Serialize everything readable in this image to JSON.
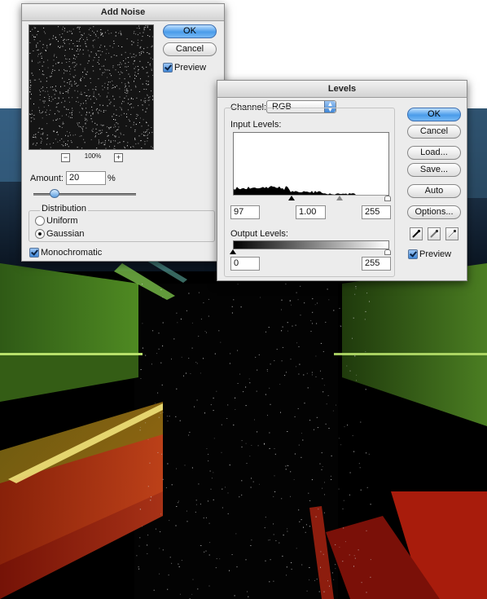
{
  "add_noise": {
    "title": "Add Noise",
    "ok_label": "OK",
    "cancel_label": "Cancel",
    "preview_label": "Preview",
    "preview_checked": true,
    "zoom_label": "100%",
    "zoom_out_symbol": "−",
    "zoom_in_symbol": "+",
    "amount_label": "Amount:",
    "amount_value": "20",
    "amount_unit": "%",
    "amount_level": 0.2,
    "distribution_label": "Distribution",
    "uniform_label": "Uniform",
    "gaussian_label": "Gaussian",
    "selected_distribution": "Gaussian",
    "monochromatic_label": "Monochromatic",
    "monochromatic_checked": true
  },
  "levels": {
    "title": "Levels",
    "channel_label": "Channel:",
    "channel_value": "RGB",
    "input_levels_label": "Input Levels:",
    "input_black": "97",
    "input_gamma": "1.00",
    "input_white": "255",
    "output_levels_label": "Output Levels:",
    "output_black": "0",
    "output_white": "255",
    "ok_label": "OK",
    "cancel_label": "Cancel",
    "load_label": "Load...",
    "save_label": "Save...",
    "auto_label": "Auto",
    "options_label": "Options...",
    "preview_label": "Preview",
    "preview_checked": true
  },
  "colors": {
    "default_button": "#4a9cea",
    "dialog_bg": "#ececec",
    "canvas_bg": "#000000"
  }
}
